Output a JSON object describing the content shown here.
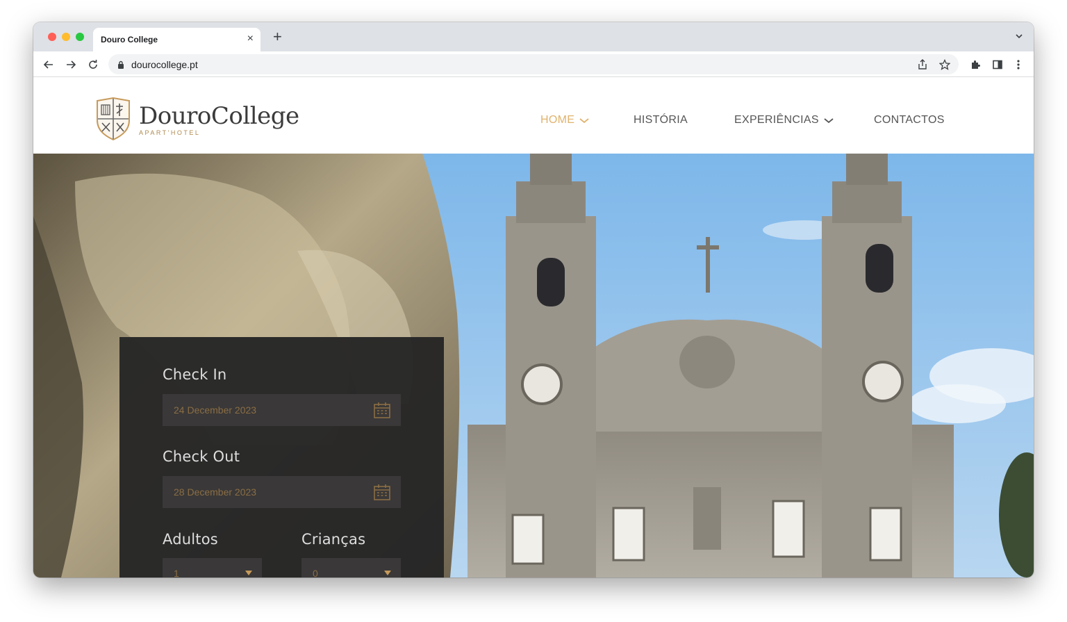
{
  "browser": {
    "tab_title": "Douro College",
    "tab_close": "×",
    "new_tab": "+",
    "url": "dourocollege.pt"
  },
  "site": {
    "logo_name": "DouroCollege",
    "logo_sub": "APART'HOTEL",
    "menu": [
      {
        "label": "HOME",
        "active": true,
        "has_dropdown": true
      },
      {
        "label": "HISTÓRIA",
        "active": false,
        "has_dropdown": false
      },
      {
        "label": "EXPERIÊNCIAS",
        "active": false,
        "has_dropdown": true
      },
      {
        "label": "CONTACTOS",
        "active": false,
        "has_dropdown": false
      }
    ]
  },
  "booking": {
    "check_in_label": "Check In",
    "check_in_value": "24 December 2023",
    "check_out_label": "Check Out",
    "check_out_value": "28 December 2023",
    "adults_label": "Adultos",
    "adults_value": "1",
    "children_label": "Crianças",
    "children_value": "0"
  },
  "colors": {
    "accent_gold": "#e0b36e",
    "panel_bg": "#262626",
    "field_bg": "#3a3838"
  }
}
